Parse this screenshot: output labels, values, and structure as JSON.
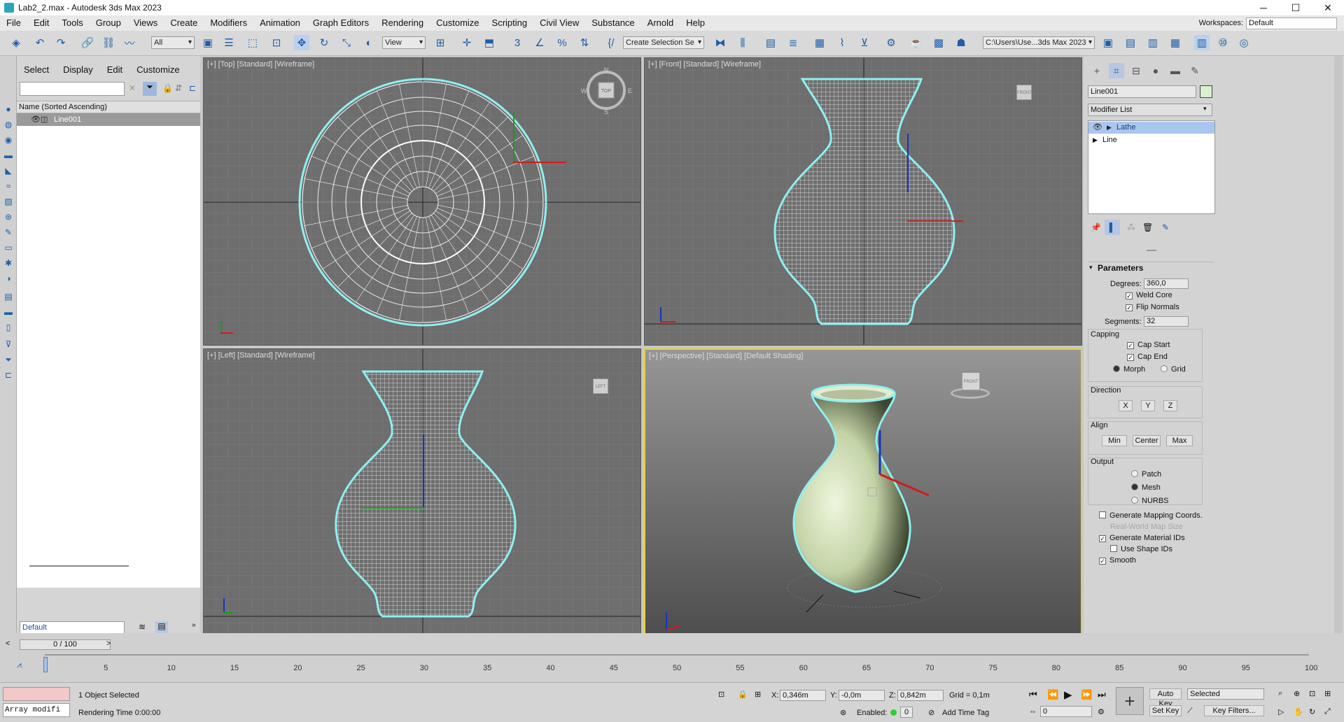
{
  "titlebar": {
    "title": "Lab2_2.max - Autodesk 3ds Max 2023",
    "minimize": "─",
    "maximize": "☐",
    "close": "✕"
  },
  "menu": [
    "File",
    "Edit",
    "Tools",
    "Group",
    "Views",
    "Create",
    "Modifiers",
    "Animation",
    "Graph Editors",
    "Rendering",
    "Customize",
    "Scripting",
    "Civil View",
    "Substance",
    "Arnold",
    "Help"
  ],
  "workspaces": {
    "label": "Workspaces:",
    "value": "Default"
  },
  "toolbar": {
    "filter": "All",
    "view": "View",
    "selection_set": "Create Selection Se",
    "path": "C:\\Users\\Use...3ds Max 2023"
  },
  "explorer": {
    "tabs": [
      "Select",
      "Display",
      "Edit",
      "Customize"
    ],
    "column_header": "Name (Sorted Ascending)",
    "object": "Line001",
    "layer": "Default",
    "time": "0 / 100"
  },
  "viewports": {
    "top": "[+] [Top] [Standard] [Wireframe]",
    "front": "[+] [Front] [Standard] [Wireframe]",
    "left": "[+] [Left] [Standard] [Wireframe]",
    "perspective": "[+] [Perspective] [Standard] [Default Shading]",
    "cube_top": "TOP",
    "cube_front": "FRONT",
    "cube_left": "LEFT",
    "cube_persp": "FRONT",
    "compass": {
      "n": "N",
      "s": "S",
      "e": "E",
      "w": "W"
    }
  },
  "command_panel": {
    "object_name": "Line001",
    "modifier_list": "Modifier List",
    "stack": [
      "Lathe",
      "Line"
    ],
    "params_title": "Parameters",
    "degrees_label": "Degrees:",
    "degrees": "360,0",
    "weld_core": "Weld Core",
    "flip_normals": "Flip Normals",
    "segments_label": "Segments:",
    "segments": "32",
    "capping": "Capping",
    "cap_start": "Cap Start",
    "cap_end": "Cap End",
    "morph": "Morph",
    "grid": "Grid",
    "direction": "Direction",
    "dir_x": "X",
    "dir_y": "Y",
    "dir_z": "Z",
    "align": "Align",
    "min": "Min",
    "center": "Center",
    "max": "Max",
    "output": "Output",
    "patch": "Patch",
    "mesh": "Mesh",
    "nurbs": "NURBS",
    "gen_mapping": "Generate Mapping Coords.",
    "real_world": "Real-World Map Size",
    "gen_matids": "Generate Material IDs",
    "use_shape_ids": "Use Shape IDs",
    "smooth": "Smooth"
  },
  "timeline": {
    "ticks": [
      "5",
      "10",
      "15",
      "20",
      "25",
      "30",
      "35",
      "40",
      "45",
      "50",
      "55",
      "60",
      "65",
      "70",
      "75",
      "80",
      "85",
      "90",
      "95",
      "100"
    ]
  },
  "status": {
    "maxscript": "Array modifi",
    "selected": "1 Object Selected",
    "render_time": "Rendering Time  0:00:00",
    "x_label": "X:",
    "x": "0,346m",
    "y_label": "Y:",
    "y": "-0,0m",
    "z_label": "Z:",
    "z": "0,842m",
    "grid": "Grid = 0,1m",
    "enabled": "Enabled:",
    "add_time_tag": "Add Time Tag",
    "frame": "0",
    "auto_key": "Auto Key",
    "set_key": "Set Key",
    "key_mode": "Selected",
    "key_filters": "Key Filters..."
  }
}
